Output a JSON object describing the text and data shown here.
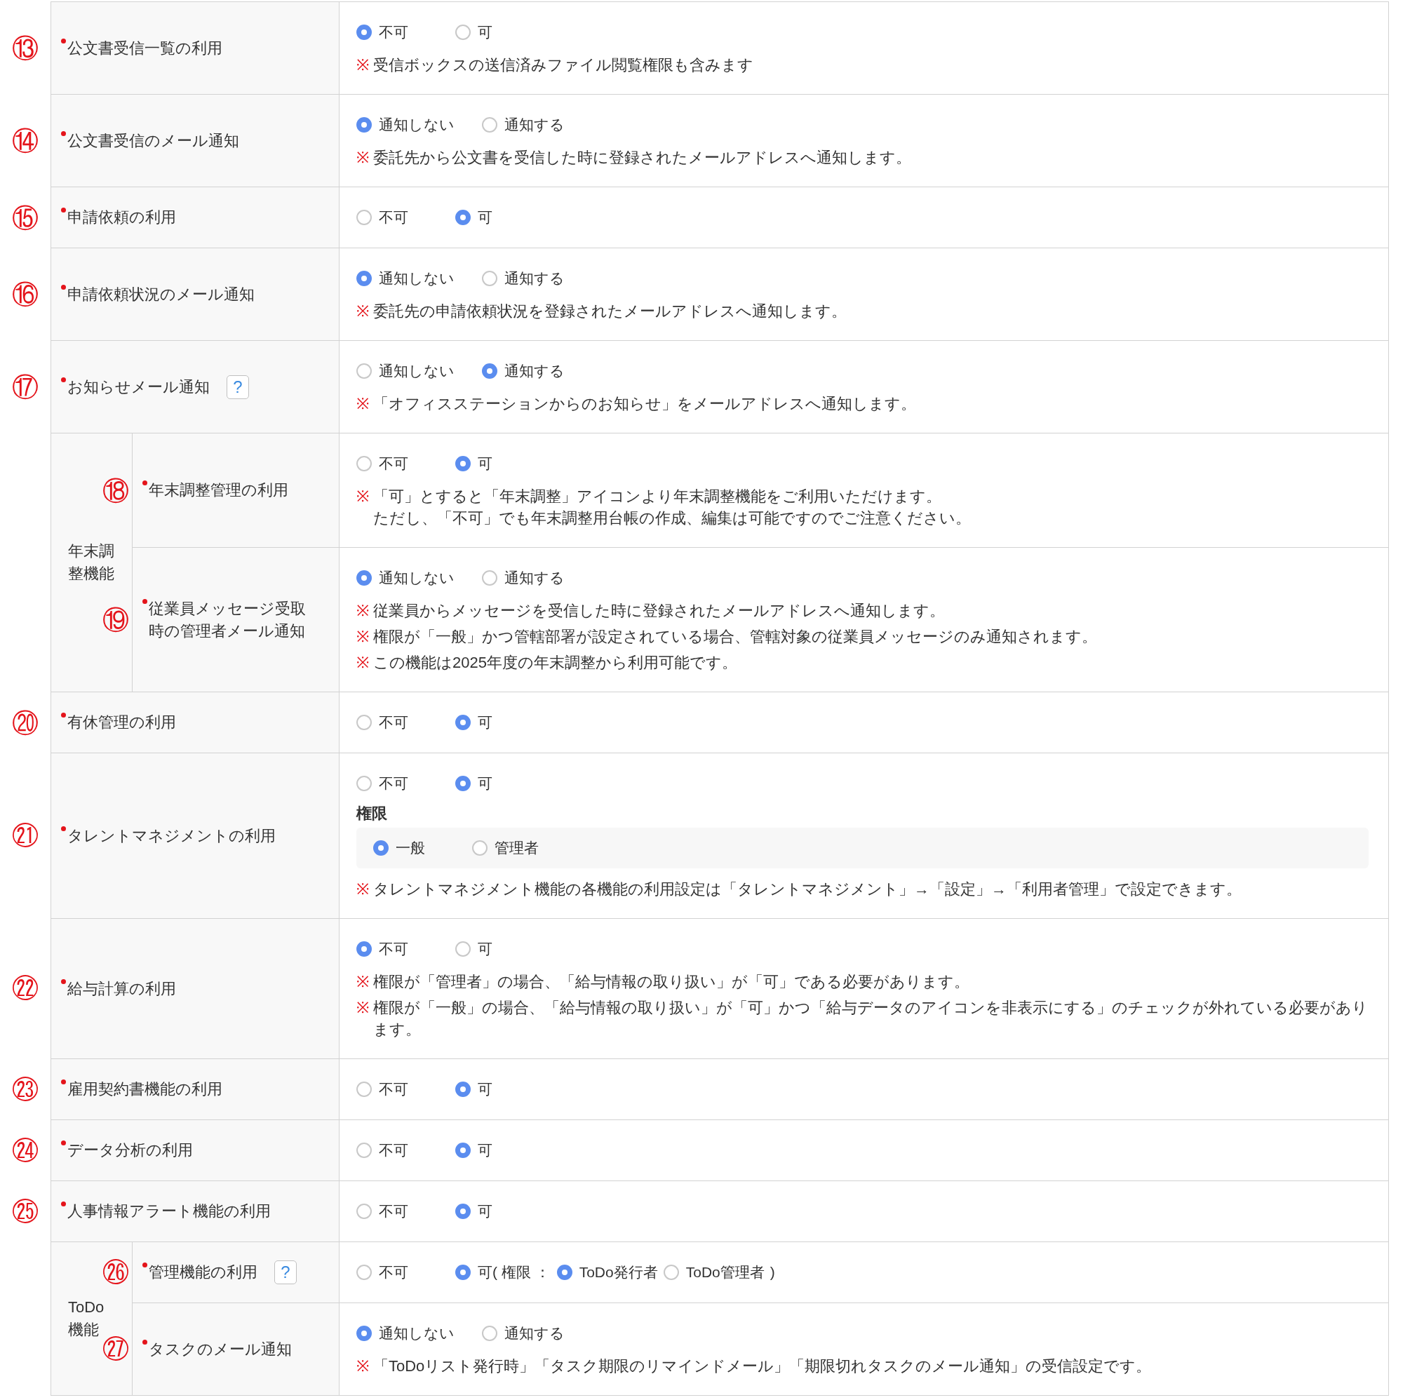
{
  "rows": [
    {
      "kind": "setting",
      "number": "⑬",
      "label": "公文書受信一覧の利用",
      "required": true,
      "options": [
        {
          "label": "不可",
          "selected": true
        },
        {
          "label": "可",
          "selected": false
        }
      ],
      "notes": [
        {
          "mark": "※",
          "text": "受信ボックスの送信済みファイル閲覧権限も含みます"
        }
      ]
    },
    {
      "kind": "setting",
      "number": "⑭",
      "label": "公文書受信のメール通知",
      "required": true,
      "options": [
        {
          "label": "通知しない",
          "selected": true
        },
        {
          "label": "通知する",
          "selected": false
        }
      ],
      "notes": [
        {
          "mark": "※",
          "text": "委託先から公文書を受信した時に登録されたメールアドレスへ通知します。"
        }
      ]
    },
    {
      "kind": "setting",
      "number": "⑮",
      "label": "申請依頼の利用",
      "required": true,
      "options": [
        {
          "label": "不可",
          "selected": false
        },
        {
          "label": "可",
          "selected": true
        }
      ]
    },
    {
      "kind": "setting",
      "number": "⑯",
      "label": "申請依頼状況のメール通知",
      "required": true,
      "options": [
        {
          "label": "通知しない",
          "selected": true
        },
        {
          "label": "通知する",
          "selected": false
        }
      ],
      "notes": [
        {
          "mark": "※",
          "text": "委託先の申請依頼状況を登録されたメールアドレスへ通知します。"
        }
      ]
    },
    {
      "kind": "setting",
      "number": "⑰",
      "label": "お知らせメール通知",
      "required": true,
      "help": "?",
      "options": [
        {
          "label": "通知しない",
          "selected": false
        },
        {
          "label": "通知する",
          "selected": true
        }
      ],
      "notes": [
        {
          "mark": "※",
          "text": "「オフィスステーションからのお知らせ」をメールアドレスへ通知します。"
        }
      ]
    },
    {
      "kind": "group",
      "label": "年末調整機能",
      "children": [
        {
          "kind": "setting",
          "number": "⑱",
          "label": "年末調整管理の利用",
          "required": true,
          "options": [
            {
              "label": "不可",
              "selected": false
            },
            {
              "label": "可",
              "selected": true
            }
          ],
          "notes": [
            {
              "mark": "※",
              "text": "「可」とすると「年末調整」アイコンより年末調整機能をご利用いただけます。",
              "continuation": "ただし、「不可」でも年末調整用台帳の作成、編集は可能ですのでご注意ください。"
            }
          ]
        },
        {
          "kind": "setting",
          "number": "⑲",
          "label": "従業員メッセージ受取時の管理者メール通知",
          "required": true,
          "options": [
            {
              "label": "通知しない",
              "selected": true
            },
            {
              "label": "通知する",
              "selected": false
            }
          ],
          "notes": [
            {
              "mark": "※",
              "text": "従業員からメッセージを受信した時に登録されたメールアドレスへ通知します。"
            },
            {
              "mark": "※",
              "text": "権限が「一般」かつ管轄部署が設定されている場合、管轄対象の従業員メッセージのみ通知されます。"
            },
            {
              "mark": "※",
              "text": "この機能は2025年度の年末調整から利用可能です。"
            }
          ]
        }
      ]
    },
    {
      "kind": "setting",
      "number": "⑳",
      "label": "有休管理の利用",
      "required": true,
      "options": [
        {
          "label": "不可",
          "selected": false
        },
        {
          "label": "可",
          "selected": true
        }
      ]
    },
    {
      "kind": "setting",
      "number": "㉑",
      "label": "タレントマネジメントの利用",
      "required": true,
      "options": [
        {
          "label": "不可",
          "selected": false
        },
        {
          "label": "可",
          "selected": true
        }
      ],
      "sub_section": {
        "heading": "権限",
        "options": [
          {
            "label": "一般",
            "selected": true
          },
          {
            "label": "管理者",
            "selected": false
          }
        ]
      },
      "notes": [
        {
          "mark": "※",
          "text": "タレントマネジメント機能の各機能の利用設定は「タレントマネジメント」→「設定」→「利用者管理」で設定できます。"
        }
      ]
    },
    {
      "kind": "setting",
      "number": "㉒",
      "label": "給与計算の利用",
      "required": true,
      "options": [
        {
          "label": "不可",
          "selected": true
        },
        {
          "label": "可",
          "selected": false
        }
      ],
      "notes": [
        {
          "mark": "※",
          "text": "権限が「管理者」の場合、「給与情報の取り扱い」が「可」である必要があります。"
        },
        {
          "mark": "※",
          "text": "権限が「一般」の場合、「給与情報の取り扱い」が「可」かつ「給与データのアイコンを非表示にする」のチェックが外れている必要があります。"
        }
      ]
    },
    {
      "kind": "setting",
      "number": "㉓",
      "label": "雇用契約書機能の利用",
      "required": true,
      "options": [
        {
          "label": "不可",
          "selected": false
        },
        {
          "label": "可",
          "selected": true
        }
      ]
    },
    {
      "kind": "setting",
      "number": "㉔",
      "label": "データ分析の利用",
      "required": true,
      "options": [
        {
          "label": "不可",
          "selected": false
        },
        {
          "label": "可",
          "selected": true
        }
      ]
    },
    {
      "kind": "setting",
      "number": "㉕",
      "label": "人事情報アラート機能の利用",
      "required": true,
      "options": [
        {
          "label": "不可",
          "selected": false
        },
        {
          "label": "可",
          "selected": true
        }
      ]
    },
    {
      "kind": "group",
      "label": "ToDo機能",
      "children": [
        {
          "kind": "setting",
          "number": "㉖",
          "label": "管理機能の利用",
          "required": true,
          "help": "?",
          "options": [
            {
              "label": "不可",
              "selected": false
            },
            {
              "label": "可( 権限 ：",
              "selected": true,
              "sub_options": [
                {
                  "label": "ToDo発行者",
                  "selected": true
                },
                {
                  "label": "ToDo管理者",
                  "selected": false
                }
              ],
              "suffix": ")"
            }
          ]
        },
        {
          "kind": "setting",
          "number": "㉗",
          "label": "タスクのメール通知",
          "required": true,
          "options": [
            {
              "label": "通知しない",
              "selected": true
            },
            {
              "label": "通知する",
              "selected": false
            }
          ],
          "notes": [
            {
              "mark": "※",
              "text": "「ToDoリスト発行時」「タスク期限のリマインドメール」「期限切れタスクのメール通知」の受信設定です。"
            }
          ]
        }
      ]
    }
  ]
}
